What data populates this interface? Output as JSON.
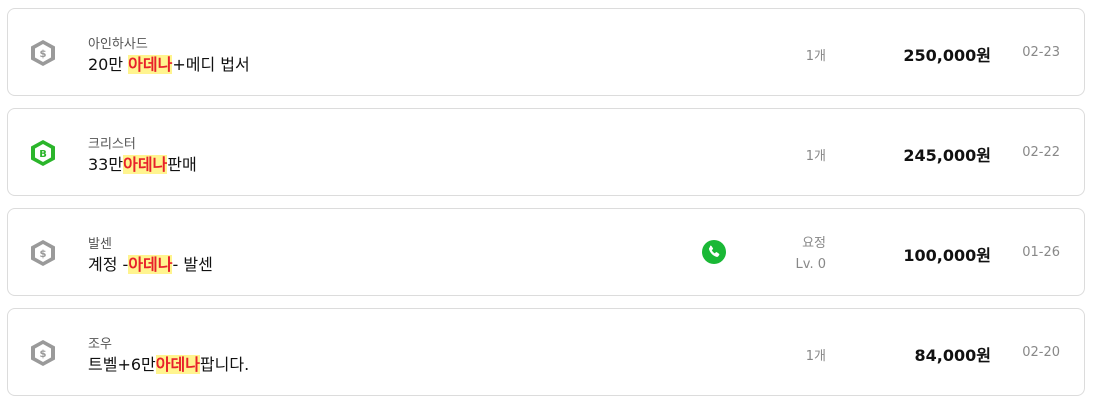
{
  "colors": {
    "highlight_bg": "#fff48f",
    "highlight_text": "#e8202a",
    "badge_gray": "#9a9a9a",
    "badge_green": "#2bb52b",
    "phone_green": "#1ab836"
  },
  "items": [
    {
      "seller": "아인하사드",
      "title_pre": "20만 ",
      "title_hl": "아데나",
      "title_post": "+메디 법서",
      "badge_icon": "gray-dollar-hexagon-icon",
      "quantity": "1개",
      "price": "250,000원",
      "date": "02-23"
    },
    {
      "seller": "크리스터",
      "title_pre": "33만",
      "title_hl": "아데나",
      "title_post": "판매",
      "badge_icon": "green-b-hexagon-icon",
      "quantity": "1개",
      "price": "245,000원",
      "date": "02-22"
    },
    {
      "seller": "발센",
      "title_pre": "계정 -",
      "title_hl": "아데나",
      "title_post": "- 발센",
      "badge_icon": "gray-dollar-hexagon-icon",
      "phone_icon": "phone-icon",
      "quantity_line1": "요정",
      "quantity_line2": "Lv. 0",
      "price": "100,000원",
      "date": "01-26"
    },
    {
      "seller": "조우",
      "title_pre": "트벨+6만",
      "title_hl": "아데나",
      "title_post": "팝니다.",
      "badge_icon": "gray-dollar-hexagon-icon",
      "quantity": "1개",
      "price": "84,000원",
      "date": "02-20"
    }
  ]
}
